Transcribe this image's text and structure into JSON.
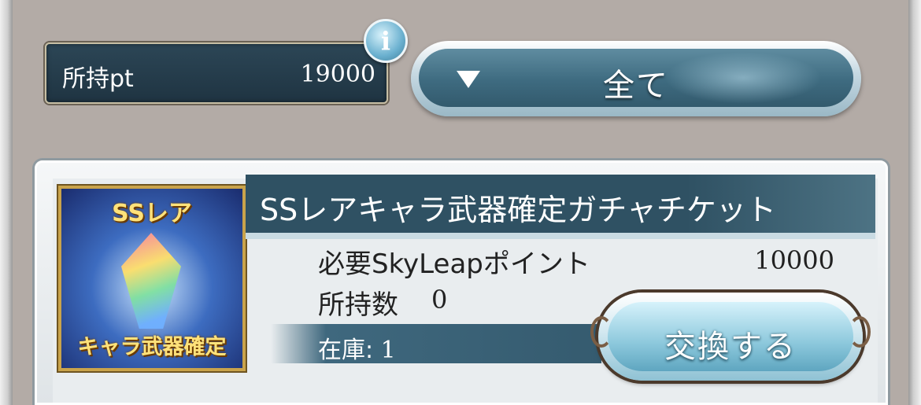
{
  "points": {
    "label": "所持pt",
    "value": "19000"
  },
  "info_icon": {
    "glyph": "i"
  },
  "filter": {
    "label": "全て"
  },
  "item": {
    "name": "SSレアキャラ武器確定ガチャチケット",
    "thumbnail": {
      "top_text": "SSレア",
      "bottom_text": "キャラ武器確定"
    },
    "cost_label": "必要SkyLeapポイント",
    "cost_value": "10000",
    "owned_label": "所持数",
    "owned_value": "0",
    "stock_label": "在庫: ",
    "stock_value": "1",
    "exchange_label": "交換する"
  },
  "colors": {
    "panel_dark": "#2f5163",
    "button_light": "#d6f2fb",
    "gold_text": "#ffe27a",
    "background": "#b3aba6"
  }
}
